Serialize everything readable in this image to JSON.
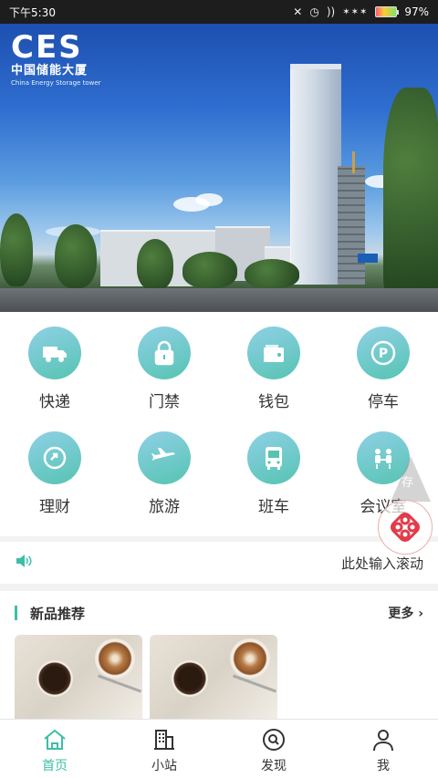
{
  "status_bar": {
    "time": "下午5:30",
    "battery_percent": "97%"
  },
  "banner": {
    "logo_text": "CES",
    "logo_cn": "中国储能大厦",
    "logo_en": "China Energy Storage tower"
  },
  "grid": {
    "items": [
      {
        "label": "快递",
        "icon": "truck-icon"
      },
      {
        "label": "门禁",
        "icon": "lock-icon"
      },
      {
        "label": "钱包",
        "icon": "wallet-icon"
      },
      {
        "label": "停车",
        "icon": "parking-icon"
      },
      {
        "label": "理财",
        "icon": "finance-icon"
      },
      {
        "label": "旅游",
        "icon": "airplane-icon"
      },
      {
        "label": "班车",
        "icon": "bus-icon"
      },
      {
        "label": "会议室",
        "icon": "meeting-icon"
      }
    ]
  },
  "marquee": {
    "text": "此处输入滚动"
  },
  "section": {
    "title": "新品推荐",
    "more": "更多"
  },
  "float_label": "存",
  "tabs": [
    {
      "label": "首页",
      "icon": "home-icon",
      "active": true
    },
    {
      "label": "小站",
      "icon": "building-icon",
      "active": false
    },
    {
      "label": "发现",
      "icon": "discover-icon",
      "active": false
    },
    {
      "label": "我",
      "icon": "person-icon",
      "active": false
    }
  ],
  "colors": {
    "accent": "#3cbfa8",
    "icon_gradient_top": "#8fd0e6",
    "icon_gradient_bottom": "#56c4b2"
  }
}
